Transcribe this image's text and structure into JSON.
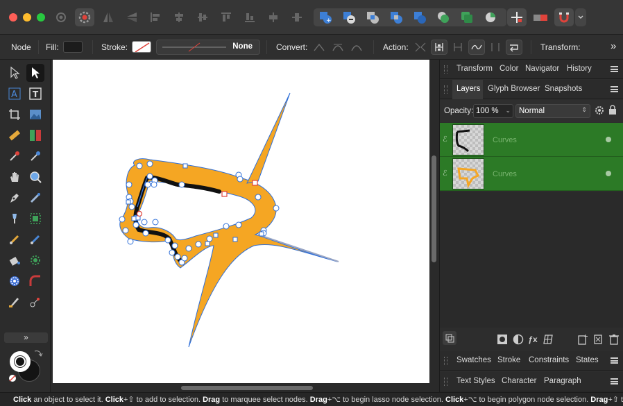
{
  "context_toolbar": {
    "mode": "Node",
    "fill_label": "Fill:",
    "stroke_label": "Stroke:",
    "stroke_value": "None",
    "convert_label": "Convert:",
    "action_label": "Action:",
    "transform_label": "Transform:",
    "more": "»"
  },
  "tools": {
    "expand": "»"
  },
  "panels": {
    "top_tabs": [
      "Transform",
      "Color",
      "Navigator",
      "History"
    ],
    "layer_tabs": [
      "Layers",
      "Glyph Browser",
      "Snapshots"
    ],
    "opacity_label": "Opacity:",
    "opacity_value": "100 %",
    "blend_mode": "Normal",
    "layers": [
      {
        "name": "Curves"
      },
      {
        "name": "Curves"
      }
    ],
    "bottom_tabs_1": [
      "Swatches",
      "Stroke",
      "Constraints",
      "States"
    ],
    "bottom_tabs_2": [
      "Text Styles",
      "Character",
      "Paragraph"
    ]
  },
  "status": {
    "parts": [
      {
        "b": "Click",
        "t": " an object to select it. "
      },
      {
        "b": "Click",
        "t": "+⇧ to add to selection. "
      },
      {
        "b": "Drag",
        "t": " to marquee select nodes. "
      },
      {
        "b": "Drag",
        "t": "+⌥ to begin lasso node selection. "
      },
      {
        "b": "Click",
        "t": "+⌥ to begin polygon node selection. "
      },
      {
        "b": "Drag",
        "t": "+⇧ to"
      }
    ]
  },
  "colors": {
    "accent_orange": "#f5a623",
    "layer_selected": "#2c7a26",
    "canvas": "#ffffff",
    "selection_blue": "#2f6fd8"
  }
}
